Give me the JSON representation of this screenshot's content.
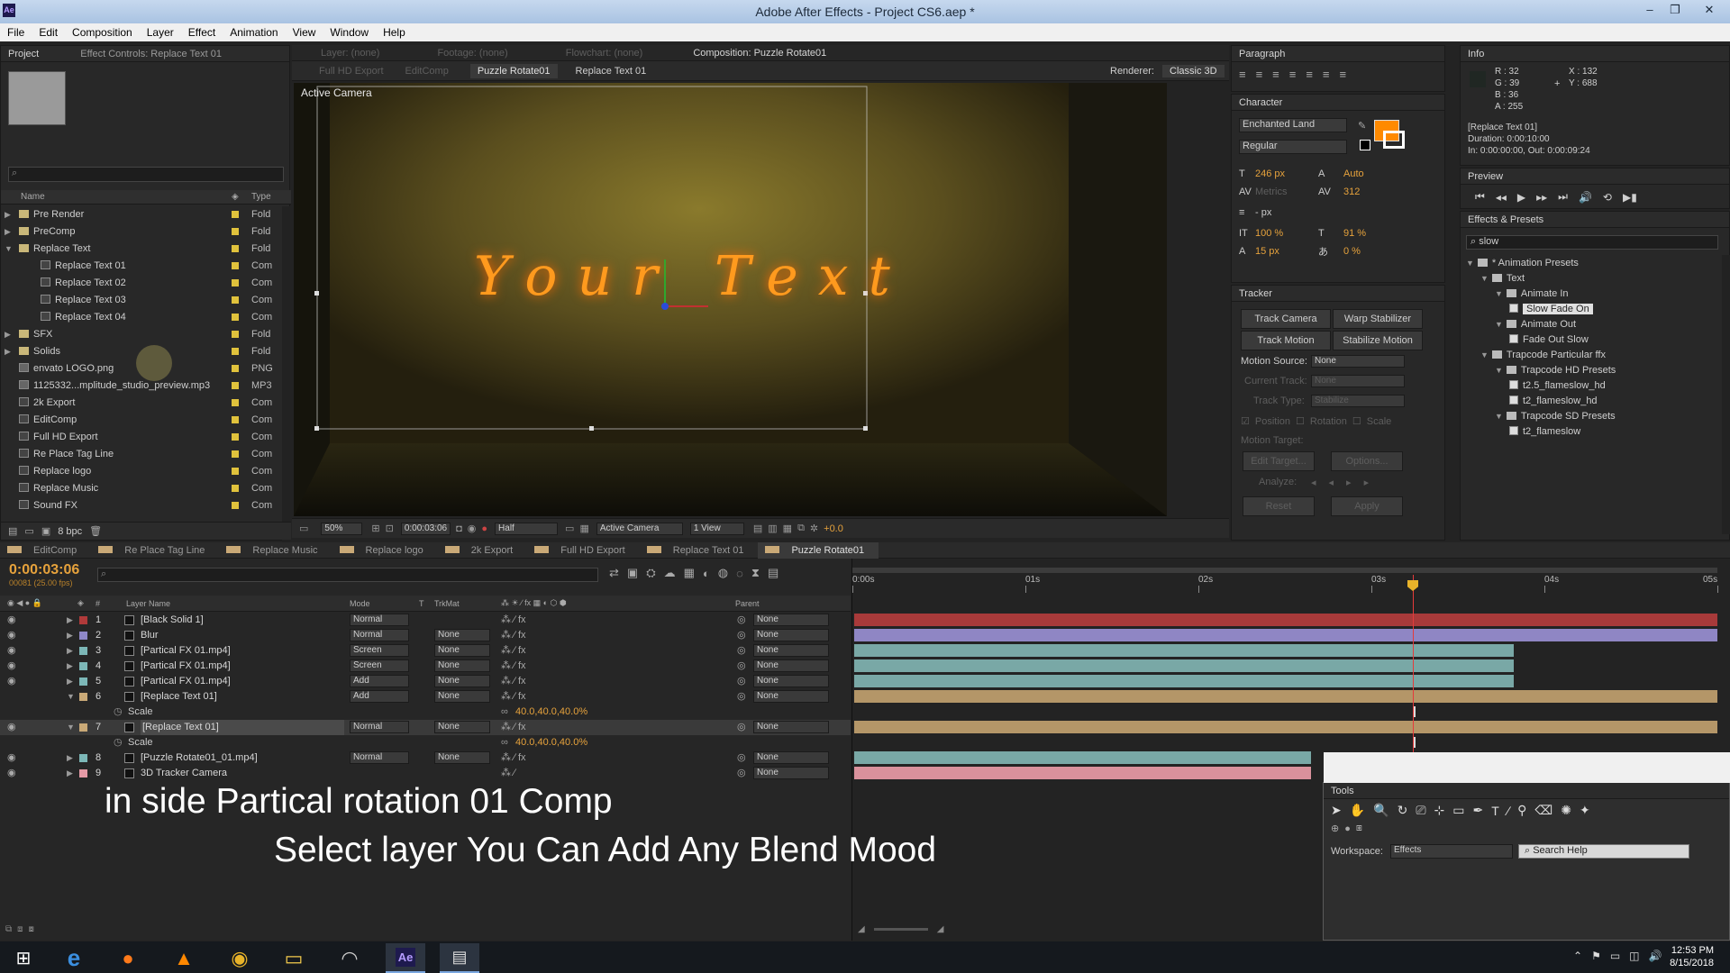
{
  "window": {
    "title": "Adobe After Effects - Project CS6.aep *",
    "app_badge": "Ae"
  },
  "menu": [
    "File",
    "Edit",
    "Composition",
    "Layer",
    "Effect",
    "Animation",
    "View",
    "Window",
    "Help"
  ],
  "project_panel": {
    "tabs": [
      "Project",
      "Effect Controls: Replace Text 01"
    ],
    "columns": {
      "name": "Name",
      "type": "Type"
    },
    "items": [
      {
        "name": "Pre Render",
        "type": "Fold",
        "kind": "folder",
        "indent": 0
      },
      {
        "name": "PreComp",
        "type": "Fold",
        "kind": "folder",
        "indent": 0
      },
      {
        "name": "Replace Text",
        "type": "Fold",
        "kind": "folder",
        "indent": 0,
        "open": true
      },
      {
        "name": "Replace Text 01",
        "type": "Com",
        "kind": "comp",
        "indent": 1
      },
      {
        "name": "Replace Text 02",
        "type": "Com",
        "kind": "comp",
        "indent": 1
      },
      {
        "name": "Replace Text 03",
        "type": "Com",
        "kind": "comp",
        "indent": 1
      },
      {
        "name": "Replace Text 04",
        "type": "Com",
        "kind": "comp",
        "indent": 1
      },
      {
        "name": "SFX",
        "type": "Fold",
        "kind": "folder",
        "indent": 0
      },
      {
        "name": "Solids",
        "type": "Fold",
        "kind": "folder",
        "indent": 0
      },
      {
        "name": "envato LOGO.png",
        "type": "PNG",
        "kind": "file",
        "indent": 0
      },
      {
        "name": "1125332...mplitude_studio_preview.mp3",
        "type": "MP3",
        "kind": "file",
        "indent": 0
      },
      {
        "name": "2k Export",
        "type": "Com",
        "kind": "comp",
        "indent": 0
      },
      {
        "name": "EditComp",
        "type": "Com",
        "kind": "comp",
        "indent": 0
      },
      {
        "name": "Full HD Export",
        "type": "Com",
        "kind": "comp",
        "indent": 0
      },
      {
        "name": "Re Place Tag Line",
        "type": "Com",
        "kind": "comp",
        "indent": 0
      },
      {
        "name": "Replace logo",
        "type": "Com",
        "kind": "comp",
        "indent": 0
      },
      {
        "name": "Replace Music",
        "type": "Com",
        "kind": "comp",
        "indent": 0
      },
      {
        "name": "Sound FX",
        "type": "Com",
        "kind": "comp",
        "indent": 0
      }
    ],
    "bpc": "8 bpc"
  },
  "viewer": {
    "header_tabs": [
      "Layer: (none)",
      "Footage: (none)",
      "Flowchart: (none)",
      "Composition: Puzzle Rotate01"
    ],
    "breadcrumbs": [
      "Full HD Export",
      "EditComp",
      "Puzzle Rotate01",
      "Replace Text 01"
    ],
    "renderer_label": "Renderer:",
    "renderer": "Classic 3D",
    "camera_label": "Active Camera",
    "comp_text": "Your Text",
    "zoom": "50%",
    "timecode": "0:00:03:06",
    "resolution": "Half",
    "view": "Active Camera",
    "views": "1 View",
    "exposure": "+0.0"
  },
  "paragraph": {
    "title": "Paragraph"
  },
  "character": {
    "title": "Character",
    "font": "Enchanted Land",
    "style": "Regular",
    "size": "246 px",
    "leading": "Auto",
    "kerning": "Metrics",
    "tracking": "312",
    "stroke": "- px",
    "vscale": "100 %",
    "hscale": "91 %",
    "baseline": "15 px",
    "tsume": "0 %",
    "fill_color": "#ff8a00"
  },
  "tracker": {
    "title": "Tracker",
    "buttons": [
      "Track Camera",
      "Warp Stabilizer",
      "Track Motion",
      "Stabilize Motion"
    ],
    "motion_source_label": "Motion Source:",
    "motion_source": "None",
    "current_track_label": "Current Track:",
    "current_track": "None",
    "track_type_label": "Track Type:",
    "track_type": "Stabilize",
    "checks": [
      "Position",
      "Rotation",
      "Scale"
    ],
    "motion_target": "Motion Target:",
    "edit_target": "Edit Target...",
    "options": "Options...",
    "analyze": "Analyze:",
    "reset": "Reset",
    "apply": "Apply"
  },
  "info": {
    "title": "Info",
    "r": "R : 32",
    "g": "G : 39",
    "b": "B : 36",
    "a": "A : 255",
    "x": "X : 132",
    "y": "Y : 688",
    "layer": "[Replace Text 01]",
    "duration": "Duration: 0:00:10:00",
    "inout": "In: 0:00:00:00, Out: 0:00:09:24"
  },
  "preview": {
    "title": "Preview"
  },
  "effects_presets": {
    "title": "Effects & Presets",
    "search": "slow",
    "tree": [
      {
        "label": "* Animation Presets",
        "indent": 0,
        "kind": "folder"
      },
      {
        "label": "Text",
        "indent": 1,
        "kind": "folder"
      },
      {
        "label": "Animate In",
        "indent": 2,
        "kind": "folder"
      },
      {
        "label": "Slow Fade On",
        "indent": 3,
        "kind": "preset",
        "selected": true
      },
      {
        "label": "Animate Out",
        "indent": 2,
        "kind": "folder"
      },
      {
        "label": "Fade Out Slow",
        "indent": 3,
        "kind": "preset"
      },
      {
        "label": "Trapcode Particular ffx",
        "indent": 1,
        "kind": "folder"
      },
      {
        "label": "Trapcode HD Presets",
        "indent": 2,
        "kind": "folder"
      },
      {
        "label": "t2.5_flameslow_hd",
        "indent": 3,
        "kind": "preset"
      },
      {
        "label": "t2_flameslow_hd",
        "indent": 3,
        "kind": "preset"
      },
      {
        "label": "Trapcode SD Presets",
        "indent": 2,
        "kind": "folder"
      },
      {
        "label": "t2_flameslow",
        "indent": 3,
        "kind": "preset"
      }
    ]
  },
  "timeline": {
    "tabs": [
      "EditComp",
      "Re Place Tag Line",
      "Replace Music",
      "Replace logo",
      "2k Export",
      "Full HD Export",
      "Replace Text 01",
      "Puzzle Rotate01"
    ],
    "timecode": "0:00:03:06",
    "frames": "00081 (25.00 fps)",
    "columns": {
      "num": "#",
      "name": "Layer Name",
      "mode": "Mode",
      "t": "T",
      "trkmat": "TrkMat",
      "parent": "Parent"
    },
    "ruler": [
      "0:00s",
      "01s",
      "02s",
      "03s",
      "04s",
      "05s"
    ],
    "layers": [
      {
        "num": "1",
        "name": "[Black Solid 1]",
        "mode": "Normal",
        "trkmat": "",
        "parent": "None",
        "color": "#b03a3a",
        "bar": "#a83a3a",
        "bar_end": 1
      },
      {
        "num": "2",
        "name": "Blur",
        "mode": "Normal",
        "trkmat": "None",
        "parent": "None",
        "color": "#8f88c8",
        "bar": "#8f86c4",
        "bar_end": 1
      },
      {
        "num": "3",
        "name": "[Partical FX 01.mp4]",
        "mode": "Screen",
        "trkmat": "None",
        "parent": "None",
        "color": "#7cb7b7",
        "bar": "#79a8a6",
        "bar_end": 0.765
      },
      {
        "num": "4",
        "name": "[Partical FX 01.mp4]",
        "mode": "Screen",
        "trkmat": "None",
        "parent": "None",
        "color": "#7cb7b7",
        "bar": "#79a8a6",
        "bar_end": 0.765
      },
      {
        "num": "5",
        "name": "[Partical FX 01.mp4]",
        "mode": "Add",
        "trkmat": "None",
        "parent": "None",
        "color": "#7cb7b7",
        "bar": "#79a8a6",
        "bar_end": 0.765
      },
      {
        "num": "6",
        "name": "[Replace Text 01]",
        "mode": "Add",
        "trkmat": "None",
        "parent": "None",
        "color": "#c9a977",
        "bar": "#b49668",
        "bar_end": 1,
        "expanded": true,
        "sub": "Scale",
        "sub_value": "40.0,40.0,40.0%"
      },
      {
        "num": "7",
        "name": "[Replace Text 01]",
        "mode": "Normal",
        "trkmat": "None",
        "parent": "None",
        "color": "#c9a977",
        "bar": "#b49668",
        "bar_end": 1,
        "selected": true,
        "expanded": true,
        "sub": "Scale",
        "sub_value": "40.0,40.0,40.0%"
      },
      {
        "num": "8",
        "name": "[Puzzle Rotate01_01.mp4]",
        "mode": "Normal",
        "trkmat": "None",
        "parent": "None",
        "color": "#7cb7b7",
        "bar": "#79a8a6",
        "bar_end": 0.53
      },
      {
        "num": "9",
        "name": "3D Tracker Camera",
        "mode": "",
        "trkmat": "",
        "parent": "None",
        "color": "#e59aa6",
        "bar": "#d9919c",
        "bar_end": 0.53
      }
    ],
    "playhead_sec": 3.24,
    "duration_sec": 5
  },
  "tools": {
    "title": "Tools",
    "workspace_label": "Workspace:",
    "workspace": "Effects",
    "search_help": "Search Help"
  },
  "subtitles": [
    "in side Partical rotation 01 Comp",
    "Select layer You Can Add Any Blend Mood"
  ],
  "taskbar": {
    "time": "12:53 PM",
    "date": "8/15/2018",
    "apps": [
      "ie-icon",
      "firefox-icon",
      "vlc-icon",
      "chrome-icon",
      "explorer-icon",
      "cortana-icon",
      "after-effects-icon",
      "app-icon"
    ]
  }
}
